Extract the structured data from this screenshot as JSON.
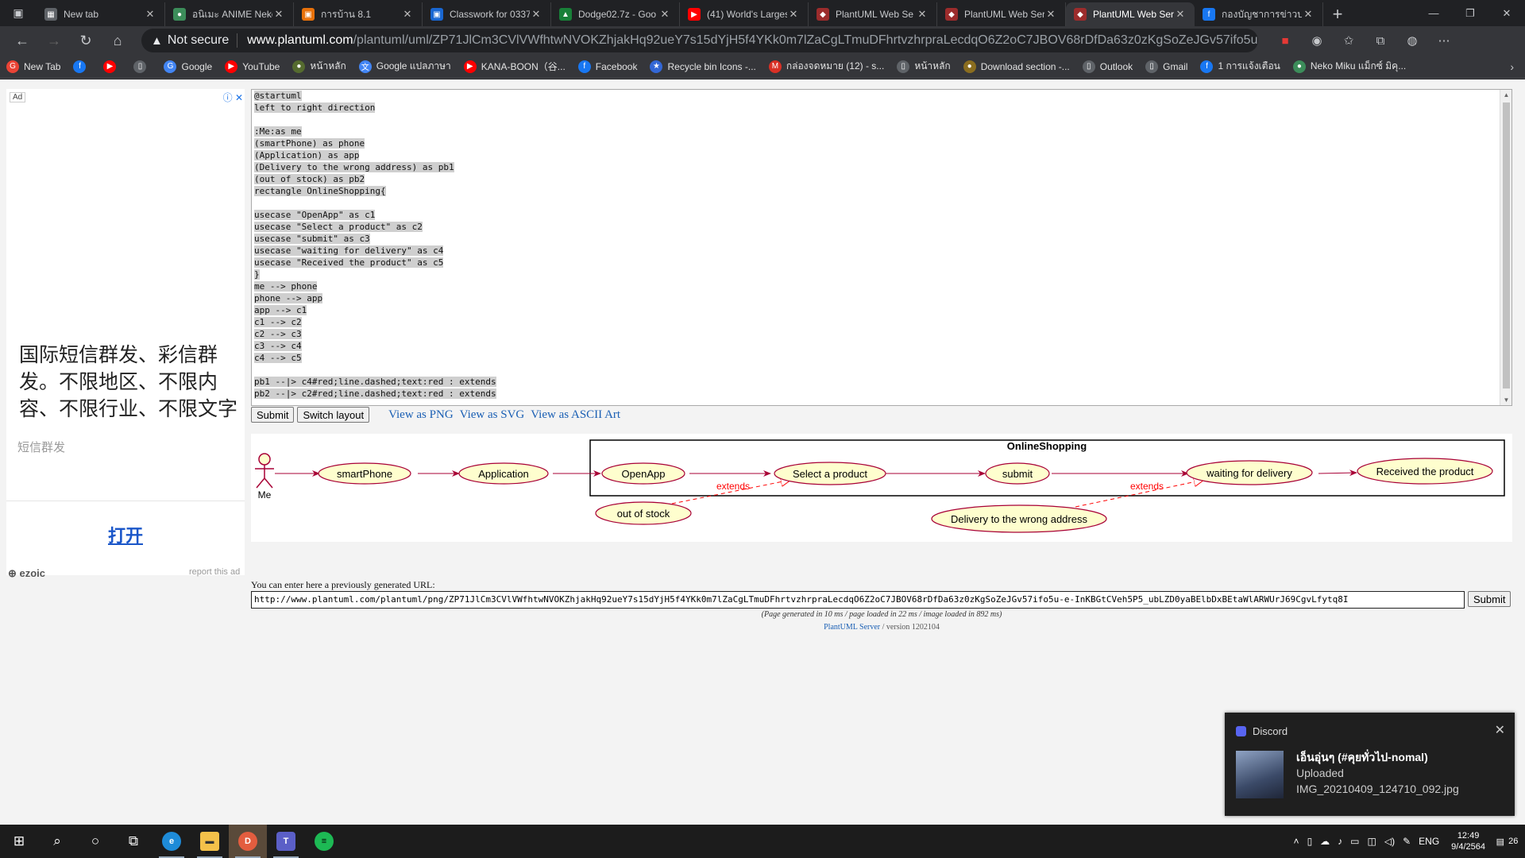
{
  "browser": {
    "tabs": [
      {
        "label": "New tab",
        "color": "#5f6368",
        "glyph": "▦"
      },
      {
        "label": "อนิเมะ ANIME Neko",
        "color": "#3c8d5a",
        "glyph": "●"
      },
      {
        "label": "การบ้าน 8.1",
        "color": "#e8710a",
        "glyph": "▣"
      },
      {
        "label": "Classwork for 0337",
        "color": "#1967d2",
        "glyph": "▣"
      },
      {
        "label": "Dodge02.7z - Goo",
        "color": "#188038",
        "glyph": "▲"
      },
      {
        "label": "(41) World's Larges",
        "color": "#ff0000",
        "glyph": "▶"
      },
      {
        "label": "PlantUML Web Se",
        "color": "#9c2c2c",
        "glyph": "◆"
      },
      {
        "label": "PlantUML Web Ser",
        "color": "#9c2c2c",
        "glyph": "◆"
      },
      {
        "label": "PlantUML Web Ser",
        "color": "#9c2c2c",
        "glyph": "◆"
      },
      {
        "label": "กองบัญชาการข่าวปล",
        "color": "#1877f2",
        "glyph": "f"
      }
    ],
    "active_tab": 8,
    "address": {
      "security": "Not secure",
      "host": "www.plantuml.com",
      "path": "/plantuml/uml/ZP71JlCm3CVlVWfhtwNVOKZhjakHq92ueY7s15dYjH5f4YKk0m7lZaCgLTmuDFhrtvzhrpraLecdqO6Z2oC7JBOV68rDfDa63z0zKgSoZeJGv57ifo5u-..."
    },
    "bookmarks": [
      {
        "label": "New Tab",
        "color": "#ea4335",
        "glyph": "G"
      },
      {
        "label": "",
        "color": "#1877f2",
        "glyph": "f"
      },
      {
        "label": "",
        "color": "#ff0000",
        "glyph": "▶"
      },
      {
        "label": "",
        "color": "#5f6368",
        "glyph": "▯"
      },
      {
        "label": "Google",
        "color": "#4285f4",
        "glyph": "G"
      },
      {
        "label": "YouTube",
        "color": "#ff0000",
        "glyph": "▶"
      },
      {
        "label": "หน้าหลัก",
        "color": "#556b2f",
        "glyph": "●"
      },
      {
        "label": "Google แปลภาษา",
        "color": "#4285f4",
        "glyph": "文"
      },
      {
        "label": "KANA-BOON（谷...",
        "color": "#ff0000",
        "glyph": "▶"
      },
      {
        "label": "Facebook",
        "color": "#1877f2",
        "glyph": "f"
      },
      {
        "label": "Recycle bin Icons -...",
        "color": "#3367d6",
        "glyph": "★"
      },
      {
        "label": "กล่องจดหมาย (12) - s...",
        "color": "#d93025",
        "glyph": "M"
      },
      {
        "label": "หน้าหลัก",
        "color": "#5f6368",
        "glyph": "▯"
      },
      {
        "label": "Download section -...",
        "color": "#8a6d1f",
        "glyph": "●"
      },
      {
        "label": "Outlook",
        "color": "#5f6368",
        "glyph": "▯"
      },
      {
        "label": "Gmail",
        "color": "#5f6368",
        "glyph": "▯"
      },
      {
        "label": "1 การแจ้งเตือน",
        "color": "#1877f2",
        "glyph": "f"
      },
      {
        "label": "Neko Miku แม็กซ์ มิคุ...",
        "color": "#3c8d5a",
        "glyph": "●"
      }
    ]
  },
  "ad": {
    "tag": "Ad",
    "text": "国际短信群发、彩信群发。不限地区、不限内容、不限行业、不限文字",
    "sub": "短信群发",
    "open": "打开",
    "brand": "ezoic",
    "report": "report this ad"
  },
  "editor": {
    "lines": [
      "@startuml",
      "left to right direction",
      "",
      ":Me:as me",
      "(smartPhone) as phone",
      "(Application) as app",
      "(Delivery to the wrong address) as pb1",
      "(out of stock) as pb2",
      "rectangle OnlineShopping{",
      "",
      "usecase \"OpenApp\" as c1",
      "usecase \"Select a product\" as c2",
      "usecase \"submit\" as c3",
      "usecase \"waiting for delivery\" as c4",
      "usecase \"Received the product\" as c5",
      "}",
      "me --> phone",
      "phone --> app",
      "app --> c1",
      "c1 --> c2",
      "c2 --> c3",
      "c3 --> c4",
      "c4 --> c5",
      "",
      "pb1 --|> c4#red;line.dashed;text:red : extends",
      "pb2 --|> c2#red;line.dashed;text:red : extends"
    ]
  },
  "buttons": {
    "submit": "Submit",
    "switch_layout": "Switch layout",
    "view_png": "View as PNG",
    "view_svg": "View as SVG",
    "view_ascii": "View as ASCII Art"
  },
  "diagram": {
    "actor": "Me",
    "package": "OnlineShopping",
    "usecases": {
      "phone": "smartPhone",
      "app": "Application",
      "c1": "OpenApp",
      "c2": "Select a product",
      "c3": "submit",
      "c4": "waiting for delivery",
      "c5": "Received the product",
      "pb1": "Delivery to the wrong address",
      "pb2": "out of stock"
    },
    "extends_label": "extends",
    "colors": {
      "usecase_fill": "#fefece",
      "usecase_stroke": "#a80036",
      "extends": "#ff0000"
    }
  },
  "url_section": {
    "label": "You can enter here a previously generated URL:",
    "value": "http://www.plantuml.com/plantuml/png/ZP71JlCm3CVlVWfhtwNVOKZhjakHq92ueY7s15dYjH5f4YKk0m7lZaCgLTmuDFhrtvzhrpraLecdqO6Z2oC7JBOV68rDfDa63z0zKgSoZeJGv57ifo5u-e-InKBGtCVeh5P5_ubLZD0yaBElbDxBEtaWlARWUrJ69CgvLfytq8I",
    "submit": "Submit",
    "stats": "(Page generated in 10 ms / page loaded in 22 ms / image loaded in 892 ms)",
    "server_link": "PlantUML Server",
    "version": " / version 1202104"
  },
  "toast": {
    "app": "Discord",
    "title": "เอ็นอุ่นๆ (#คุยทั่วไป-nomal)",
    "line1": "Uploaded",
    "line2": "IMG_20210409_124710_092.jpg"
  },
  "taskbar": {
    "time": "12:49",
    "date": "9/4/2564",
    "lang": "ENG",
    "notif_count": "26"
  }
}
